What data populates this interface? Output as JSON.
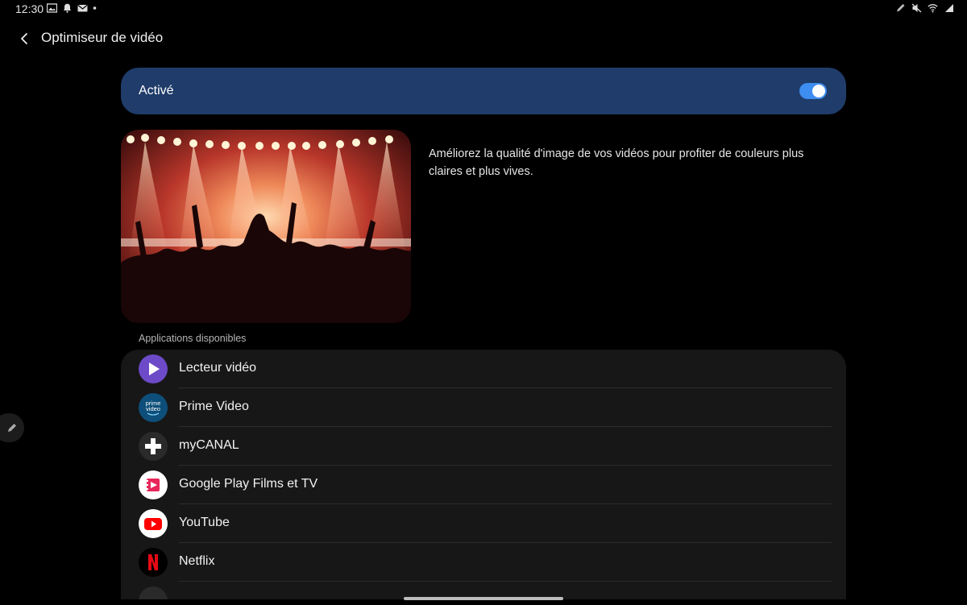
{
  "status_bar": {
    "time": "12:30",
    "left_icons": [
      "image-icon",
      "notification-bell-icon",
      "mail-icon",
      "dot-icon"
    ],
    "right_icons": [
      "pen-icon",
      "mute-icon",
      "wifi-icon",
      "signal-icon"
    ]
  },
  "header": {
    "title": "Optimiseur de vidéo",
    "back_icon": "chevron-left-icon"
  },
  "toggle": {
    "label": "Activé",
    "state": true,
    "color": "#1f3c6a",
    "switch_color": "#3e8df0"
  },
  "hero": {
    "description": "Améliorez la qualité d'image de vos vidéos pour profiter de couleurs plus claires et plus vives."
  },
  "apps": {
    "section_label": "Applications disponibles",
    "items": [
      {
        "name": "Lecteur vidéo",
        "icon": "video-player-icon"
      },
      {
        "name": "Prime Video",
        "icon": "prime-video-icon"
      },
      {
        "name": "myCANAL",
        "icon": "mycanal-icon"
      },
      {
        "name": "Google Play Films et TV",
        "icon": "google-play-movies-icon"
      },
      {
        "name": "YouTube",
        "icon": "youtube-icon"
      },
      {
        "name": "Netflix",
        "icon": "netflix-icon"
      }
    ]
  }
}
